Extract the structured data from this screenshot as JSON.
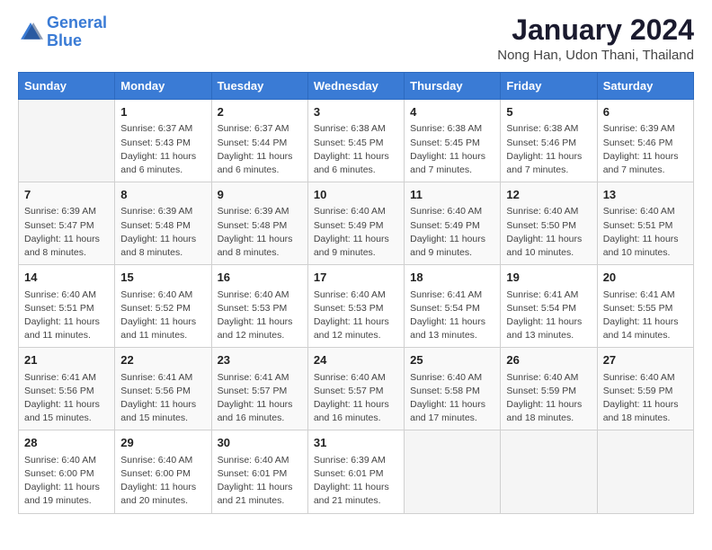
{
  "header": {
    "logo_line1": "General",
    "logo_line2": "Blue",
    "month": "January 2024",
    "location": "Nong Han, Udon Thani, Thailand"
  },
  "weekdays": [
    "Sunday",
    "Monday",
    "Tuesday",
    "Wednesday",
    "Thursday",
    "Friday",
    "Saturday"
  ],
  "weeks": [
    [
      {
        "day": "",
        "info": ""
      },
      {
        "day": "1",
        "info": "Sunrise: 6:37 AM\nSunset: 5:43 PM\nDaylight: 11 hours\nand 6 minutes."
      },
      {
        "day": "2",
        "info": "Sunrise: 6:37 AM\nSunset: 5:44 PM\nDaylight: 11 hours\nand 6 minutes."
      },
      {
        "day": "3",
        "info": "Sunrise: 6:38 AM\nSunset: 5:45 PM\nDaylight: 11 hours\nand 6 minutes."
      },
      {
        "day": "4",
        "info": "Sunrise: 6:38 AM\nSunset: 5:45 PM\nDaylight: 11 hours\nand 7 minutes."
      },
      {
        "day": "5",
        "info": "Sunrise: 6:38 AM\nSunset: 5:46 PM\nDaylight: 11 hours\nand 7 minutes."
      },
      {
        "day": "6",
        "info": "Sunrise: 6:39 AM\nSunset: 5:46 PM\nDaylight: 11 hours\nand 7 minutes."
      }
    ],
    [
      {
        "day": "7",
        "info": "Sunrise: 6:39 AM\nSunset: 5:47 PM\nDaylight: 11 hours\nand 8 minutes."
      },
      {
        "day": "8",
        "info": "Sunrise: 6:39 AM\nSunset: 5:48 PM\nDaylight: 11 hours\nand 8 minutes."
      },
      {
        "day": "9",
        "info": "Sunrise: 6:39 AM\nSunset: 5:48 PM\nDaylight: 11 hours\nand 8 minutes."
      },
      {
        "day": "10",
        "info": "Sunrise: 6:40 AM\nSunset: 5:49 PM\nDaylight: 11 hours\nand 9 minutes."
      },
      {
        "day": "11",
        "info": "Sunrise: 6:40 AM\nSunset: 5:49 PM\nDaylight: 11 hours\nand 9 minutes."
      },
      {
        "day": "12",
        "info": "Sunrise: 6:40 AM\nSunset: 5:50 PM\nDaylight: 11 hours\nand 10 minutes."
      },
      {
        "day": "13",
        "info": "Sunrise: 6:40 AM\nSunset: 5:51 PM\nDaylight: 11 hours\nand 10 minutes."
      }
    ],
    [
      {
        "day": "14",
        "info": "Sunrise: 6:40 AM\nSunset: 5:51 PM\nDaylight: 11 hours\nand 11 minutes."
      },
      {
        "day": "15",
        "info": "Sunrise: 6:40 AM\nSunset: 5:52 PM\nDaylight: 11 hours\nand 11 minutes."
      },
      {
        "day": "16",
        "info": "Sunrise: 6:40 AM\nSunset: 5:53 PM\nDaylight: 11 hours\nand 12 minutes."
      },
      {
        "day": "17",
        "info": "Sunrise: 6:40 AM\nSunset: 5:53 PM\nDaylight: 11 hours\nand 12 minutes."
      },
      {
        "day": "18",
        "info": "Sunrise: 6:41 AM\nSunset: 5:54 PM\nDaylight: 11 hours\nand 13 minutes."
      },
      {
        "day": "19",
        "info": "Sunrise: 6:41 AM\nSunset: 5:54 PM\nDaylight: 11 hours\nand 13 minutes."
      },
      {
        "day": "20",
        "info": "Sunrise: 6:41 AM\nSunset: 5:55 PM\nDaylight: 11 hours\nand 14 minutes."
      }
    ],
    [
      {
        "day": "21",
        "info": "Sunrise: 6:41 AM\nSunset: 5:56 PM\nDaylight: 11 hours\nand 15 minutes."
      },
      {
        "day": "22",
        "info": "Sunrise: 6:41 AM\nSunset: 5:56 PM\nDaylight: 11 hours\nand 15 minutes."
      },
      {
        "day": "23",
        "info": "Sunrise: 6:41 AM\nSunset: 5:57 PM\nDaylight: 11 hours\nand 16 minutes."
      },
      {
        "day": "24",
        "info": "Sunrise: 6:40 AM\nSunset: 5:57 PM\nDaylight: 11 hours\nand 16 minutes."
      },
      {
        "day": "25",
        "info": "Sunrise: 6:40 AM\nSunset: 5:58 PM\nDaylight: 11 hours\nand 17 minutes."
      },
      {
        "day": "26",
        "info": "Sunrise: 6:40 AM\nSunset: 5:59 PM\nDaylight: 11 hours\nand 18 minutes."
      },
      {
        "day": "27",
        "info": "Sunrise: 6:40 AM\nSunset: 5:59 PM\nDaylight: 11 hours\nand 18 minutes."
      }
    ],
    [
      {
        "day": "28",
        "info": "Sunrise: 6:40 AM\nSunset: 6:00 PM\nDaylight: 11 hours\nand 19 minutes."
      },
      {
        "day": "29",
        "info": "Sunrise: 6:40 AM\nSunset: 6:00 PM\nDaylight: 11 hours\nand 20 minutes."
      },
      {
        "day": "30",
        "info": "Sunrise: 6:40 AM\nSunset: 6:01 PM\nDaylight: 11 hours\nand 21 minutes."
      },
      {
        "day": "31",
        "info": "Sunrise: 6:39 AM\nSunset: 6:01 PM\nDaylight: 11 hours\nand 21 minutes."
      },
      {
        "day": "",
        "info": ""
      },
      {
        "day": "",
        "info": ""
      },
      {
        "day": "",
        "info": ""
      }
    ]
  ]
}
